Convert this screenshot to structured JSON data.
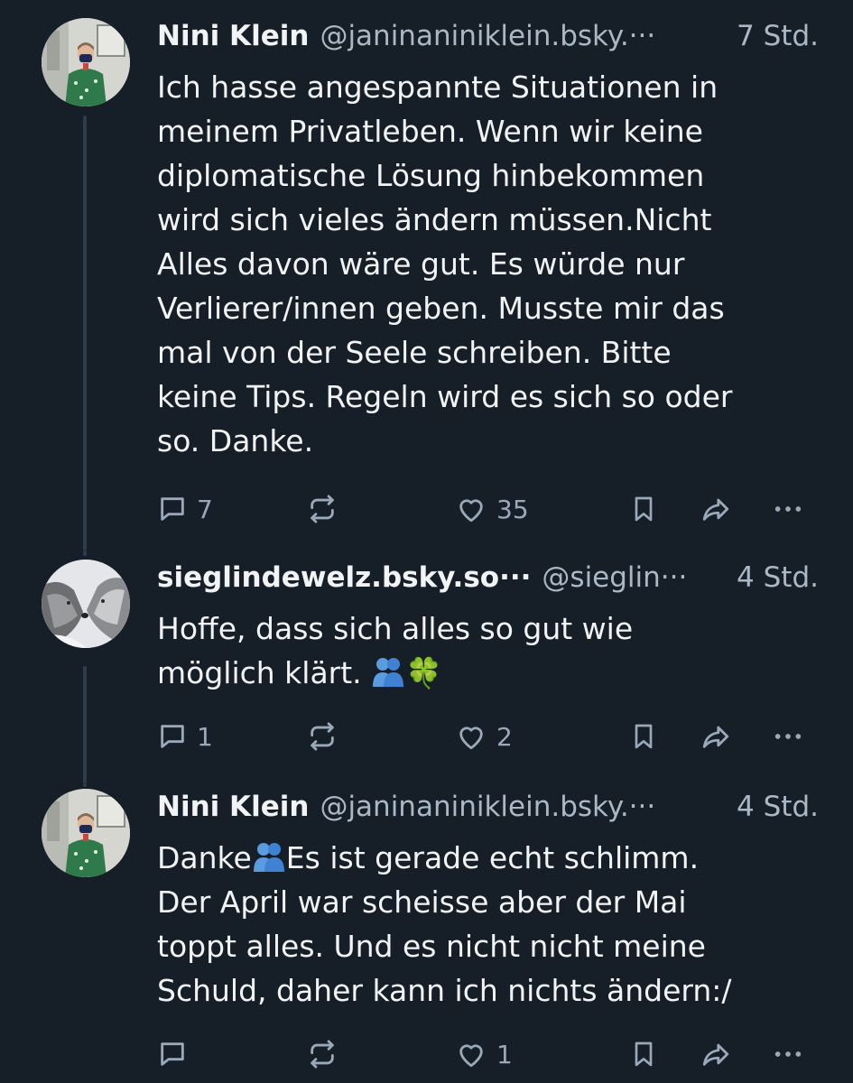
{
  "posts": [
    {
      "name": "Nini Klein",
      "handle": "@janinaniniklein.bsky.···",
      "time": "7 Std.",
      "lines": [
        "Ich hasse angespannte Situationen in",
        "meinem Privatleben. Wenn wir keine",
        "diplomatische Lösung hinbekommen",
        "wird sich vieles ändern müssen.Nicht",
        "Alles davon wäre gut. Es würde nur",
        "Verlierer/innen geben. Musste mir das",
        "mal von der Seele schreiben. Bitte",
        "keine Tips. Regeln wird es sich so oder",
        "so. Danke."
      ],
      "reply_count": "7",
      "repost_count": "",
      "like_count": "35"
    },
    {
      "name": "sieglindewelz.bsky.so···",
      "handle": "@sieglin···",
      "time": "4 Std.",
      "line1": "Hoffe, dass sich alles so gut wie",
      "line2_text": "möglich klärt.",
      "line2_emoji": "🍀",
      "reply_count": "1",
      "repost_count": "",
      "like_count": "2"
    },
    {
      "name": "Nini Klein",
      "handle": "@janinaniniklein.bsky.···",
      "time": "4 Std.",
      "line1_start": "Danke",
      "line1_end": "Es ist gerade echt schlimm.",
      "line2": "Der April war scheisse aber der Mai",
      "line3": "toppt alles. Und es nicht nicht meine",
      "line4": "Schuld, daher kann ich nichts ändern:/",
      "reply_count": "",
      "repost_count": "",
      "like_count": "1"
    }
  ],
  "colors": {
    "background": "#161e27",
    "text": "#f1f3f5",
    "secondary": "#aab8c6",
    "icon": "#9aa9b9",
    "thread_line": "#2e3c4d"
  },
  "icons": {
    "reply": "speech-bubble-icon",
    "repost": "repost-arrows-icon",
    "like": "heart-icon",
    "bookmark": "bookmark-icon",
    "share": "share-arrow-icon",
    "more": "ellipsis-icon"
  }
}
